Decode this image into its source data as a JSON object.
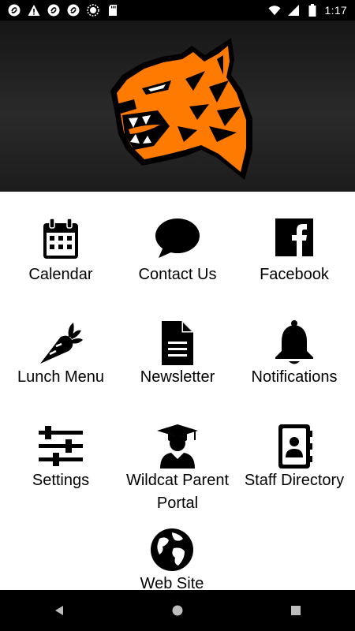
{
  "status_bar": {
    "time": "1:17",
    "icons": [
      "sync-icon",
      "alert-icon",
      "sync-icon",
      "sync-icon",
      "circle-icon",
      "sd-card-icon",
      "wifi-icon",
      "signal-icon",
      "battery-icon"
    ]
  },
  "header": {
    "logo": "wildcat-mascot-logo",
    "brand_color": "#ff7a00"
  },
  "menu": {
    "calendar": "Calendar",
    "contact_us": "Contact Us",
    "facebook": "Facebook",
    "lunch_menu": "Lunch Menu",
    "newsletter": "Newsletter",
    "notifications": "Notifications",
    "settings": "Settings",
    "parent_portal_1": "Wildcat Parent",
    "parent_portal_2": "Portal",
    "staff_directory": "Staff Directory",
    "web_site": "Web Site"
  },
  "nav": {
    "icons": [
      "back-icon",
      "home-icon",
      "recents-icon"
    ]
  }
}
